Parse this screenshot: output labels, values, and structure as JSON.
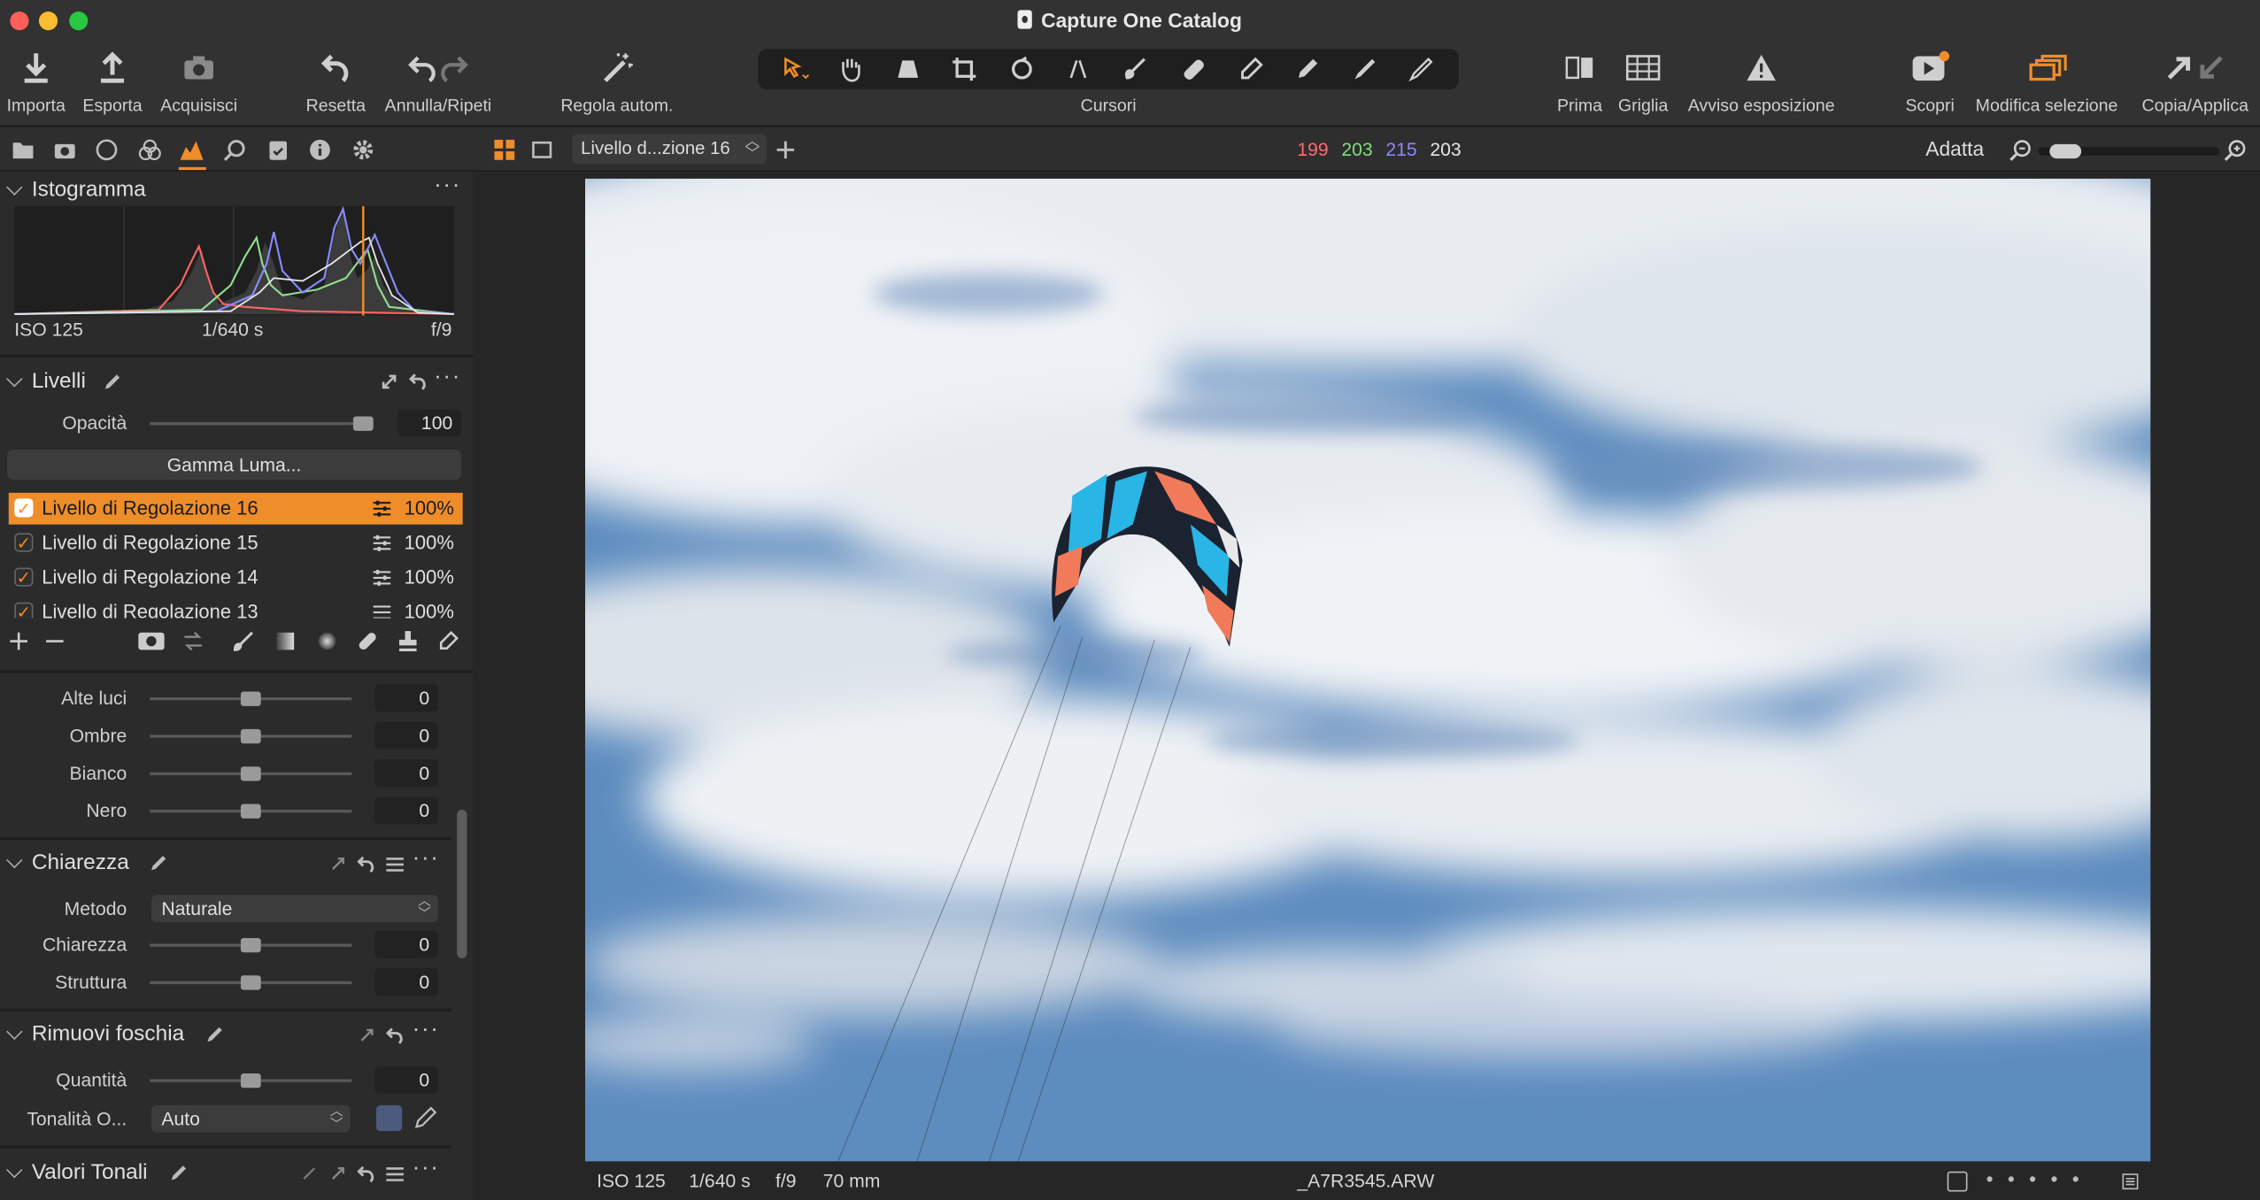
{
  "window": {
    "title": "Capture One Catalog"
  },
  "toolbar": {
    "import": "Importa",
    "export": "Esporta",
    "capture": "Acquisisci",
    "reset": "Resetta",
    "undo_redo": "Annulla/Ripeti",
    "auto_adjust": "Regola autom.",
    "cursors": "Cursori",
    "before": "Prima",
    "grid": "Griglia",
    "exposure_warning": "Avviso esposizione",
    "discover": "Scopri",
    "edit_selection": "Modifica selezione",
    "copy_apply": "Copia/Applica"
  },
  "subbar": {
    "layer_select": "Livello d...zione 16",
    "rgb": {
      "r": "199",
      "g": "203",
      "b": "215",
      "l": "203"
    },
    "fit": "Adatta",
    "zoom_level": 0.08
  },
  "histogram": {
    "title": "Istogramma",
    "iso": "ISO 125",
    "shutter": "1/640 s",
    "aperture": "f/9"
  },
  "layers": {
    "title": "Livelli",
    "opacity_label": "Opacità",
    "opacity_value": "100",
    "gamma_button": "Gamma Luma...",
    "items": [
      {
        "name": "Livello di Regolazione 16",
        "pct": "100%",
        "checked": "✓"
      },
      {
        "name": "Livello di Regolazione 15",
        "pct": "100%",
        "checked": "✓"
      },
      {
        "name": "Livello di Regolazione 14",
        "pct": "100%",
        "checked": "✓"
      },
      {
        "name": "Livello di Regolazione 13",
        "pct": "100%",
        "checked": "✓"
      }
    ]
  },
  "hdr": {
    "highlights": {
      "label": "Alte luci",
      "value": "0"
    },
    "shadows": {
      "label": "Ombre",
      "value": "0"
    },
    "white": {
      "label": "Bianco",
      "value": "0"
    },
    "black": {
      "label": "Nero",
      "value": "0"
    }
  },
  "clarity": {
    "title": "Chiarezza",
    "method_label": "Metodo",
    "method_value": "Naturale",
    "clarity": {
      "label": "Chiarezza",
      "value": "0"
    },
    "structure": {
      "label": "Struttura",
      "value": "0"
    }
  },
  "dehaze": {
    "title": "Rimuovi foschia",
    "amount": {
      "label": "Quantità",
      "value": "0"
    },
    "tone_label": "Tonalità O...",
    "tone_value": "Auto"
  },
  "tonal": {
    "title": "Valori Tonali"
  },
  "status": {
    "iso": "ISO 125",
    "shutter": "1/640 s",
    "aperture": "f/9",
    "focal": "70 mm",
    "filename": "_A7R3545.ARW"
  },
  "colors": {
    "accent": "#ef8d2a",
    "red": "#ff6b6b",
    "green": "#7ee07e",
    "blue": "#8a8aff"
  }
}
